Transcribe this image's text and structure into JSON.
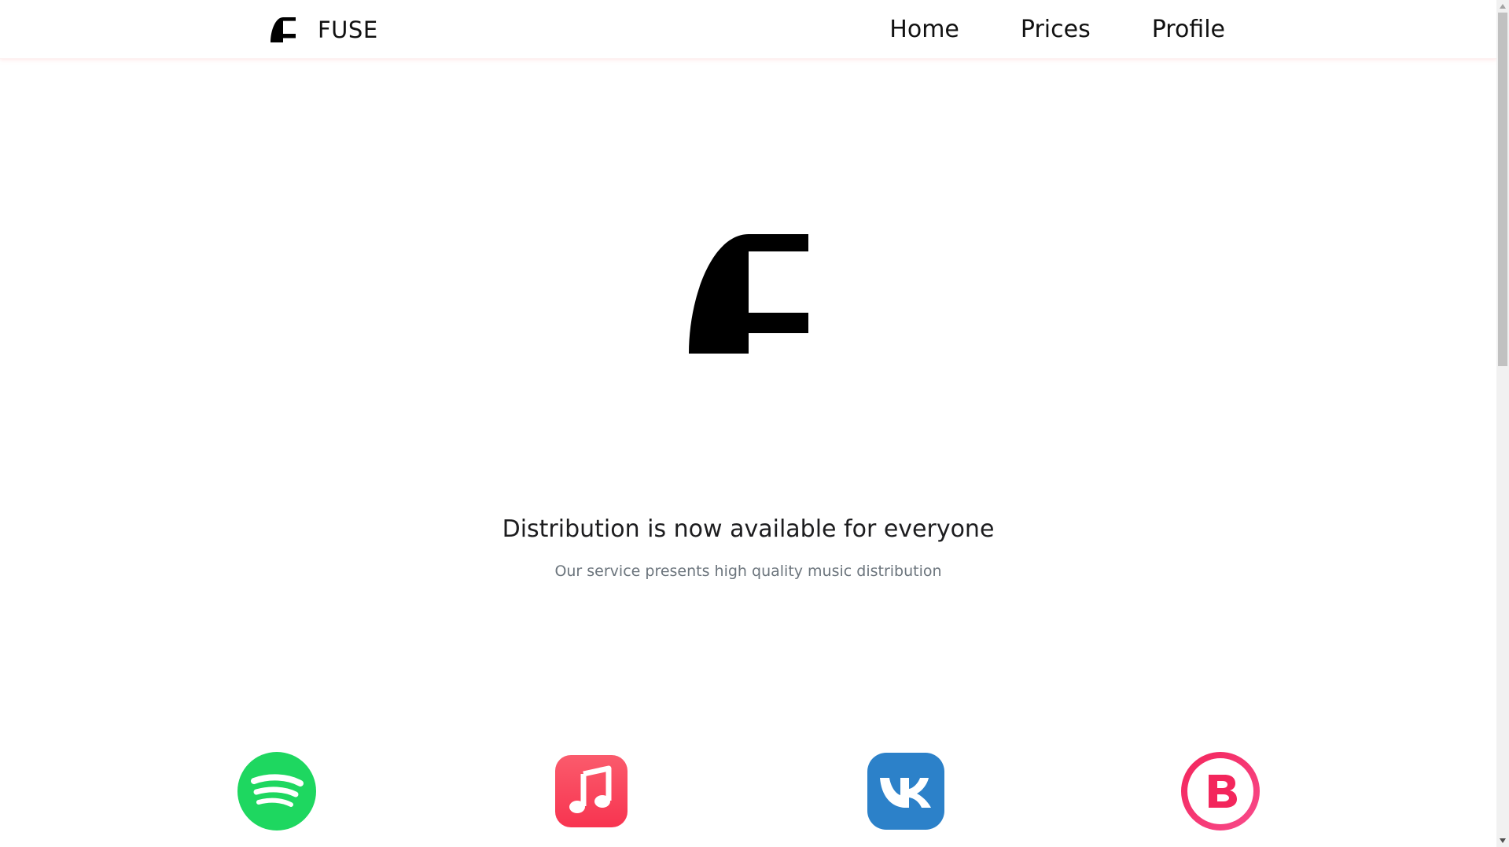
{
  "navbar": {
    "brand_text": "FUSE",
    "brand_icon": "fuse-logo-icon",
    "links": [
      {
        "label": "Home"
      },
      {
        "label": "Prices"
      },
      {
        "label": "Profile"
      }
    ]
  },
  "hero": {
    "logo_icon": "fuse-logo-icon",
    "title": "Distribution is now available for everyone",
    "subtitle": "Our service presents high quality music distribution"
  },
  "services": [
    {
      "icon": "spotify-icon",
      "color": "#1ed760"
    },
    {
      "icon": "apple-music-icon",
      "color": "#fa3e55"
    },
    {
      "icon": "vk-icon",
      "color": "#2c81c9"
    },
    {
      "icon": "boom-icon",
      "color": "#f3265c"
    }
  ],
  "colors": {
    "background": "#ffffff",
    "text": "#111111",
    "subtitle": "#6c757d",
    "navbar_shadow": "#fdf1f1"
  }
}
